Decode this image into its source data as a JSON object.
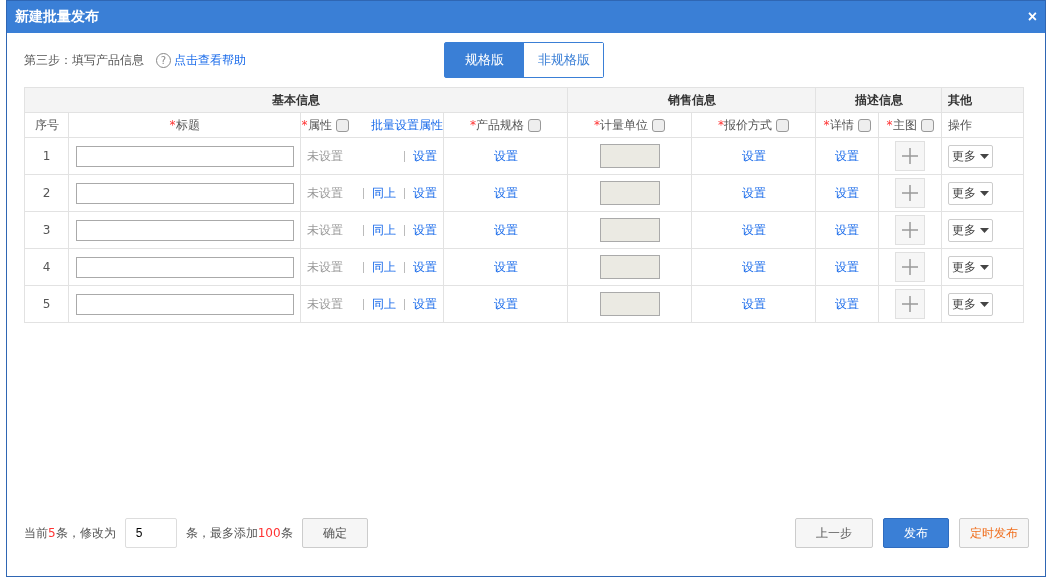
{
  "window": {
    "title": "新建批量发布",
    "close": "×"
  },
  "step": {
    "label": "第三步：填写产品信息",
    "help_icon": "?",
    "help_link": "点击查看帮助"
  },
  "tabs": [
    {
      "label": "规格版",
      "selected": true
    },
    {
      "label": "非规格版",
      "selected": false
    }
  ],
  "table": {
    "groups": [
      {
        "label": "基本信息"
      },
      {
        "label": "销售信息"
      },
      {
        "label": "描述信息"
      },
      {
        "label": "其他"
      }
    ],
    "columns": [
      {
        "label": "序号"
      },
      {
        "mark": "*",
        "label": "标题"
      },
      {
        "mark": "*",
        "label": "属性",
        "checked": false,
        "link": "批量设置属性"
      },
      {
        "mark": "*",
        "label": "产品规格",
        "checked": false
      },
      {
        "mark": "*",
        "label": "计量单位",
        "checked": false
      },
      {
        "mark": "*",
        "label": "报价方式",
        "checked": false
      },
      {
        "mark": "*",
        "label": "详情",
        "checked": false
      },
      {
        "mark": "*",
        "label": "主图",
        "checked": false
      },
      {
        "label": "操作"
      }
    ],
    "rows": [
      {
        "index": "1",
        "attr_status": "未设置",
        "attr_set": "设置",
        "spec": "设置",
        "price": "设置",
        "detail": "设置",
        "more": "更多"
      },
      {
        "index": "2",
        "attr_status": "未设置",
        "same_above": "同上",
        "attr_set": "设置",
        "spec": "设置",
        "price": "设置",
        "detail": "设置",
        "more": "更多"
      },
      {
        "index": "3",
        "attr_status": "未设置",
        "same_above": "同上",
        "attr_set": "设置",
        "spec": "设置",
        "price": "设置",
        "detail": "设置",
        "more": "更多"
      },
      {
        "index": "4",
        "attr_status": "未设置",
        "same_above": "同上",
        "attr_set": "设置",
        "spec": "设置",
        "price": "设置",
        "detail": "设置",
        "more": "更多"
      },
      {
        "index": "5",
        "attr_status": "未设置",
        "same_above": "同上",
        "attr_set": "设置",
        "spec": "设置",
        "price": "设置",
        "detail": "设置",
        "more": "更多"
      }
    ]
  },
  "footer": {
    "current": {
      "before": "当前",
      "count": "5",
      "after": "条，修改为"
    },
    "count_value": "5",
    "limit": {
      "before": "条，最多添加",
      "max": "100",
      "after": "条"
    },
    "confirm": "确定"
  },
  "buttons": [
    {
      "label": "上一步",
      "kind": "default"
    },
    {
      "label": "发布",
      "kind": "primary"
    },
    {
      "label": "定时发布",
      "kind": "warning"
    }
  ]
}
